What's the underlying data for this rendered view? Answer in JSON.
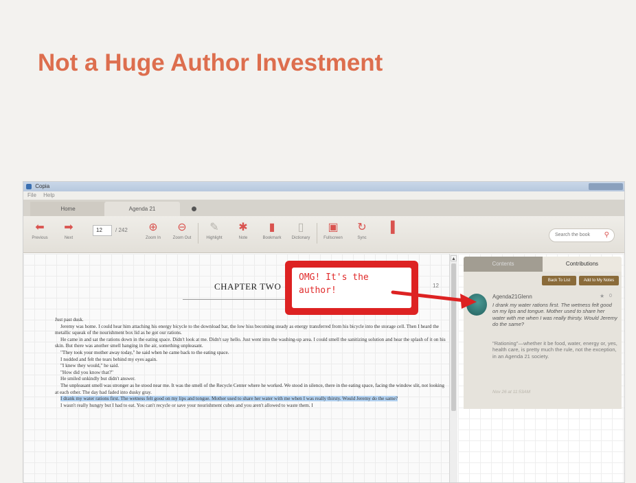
{
  "slide": {
    "title": "Not a Huge Author Investment"
  },
  "window": {
    "title": "Copia"
  },
  "menu": [
    "File",
    "Help"
  ],
  "tabs": [
    {
      "label": "Home"
    },
    {
      "label": "Agenda 21"
    }
  ],
  "toolbar": {
    "previous": "Previous",
    "next": "Next",
    "page_value": "12",
    "page_total": "/ 242",
    "zoom_in": "Zoom In",
    "zoom_out": "Zoom Out",
    "highlight": "Highlight",
    "note": "Note",
    "bookmark": "Bookmark",
    "dictionary": "Dictionary",
    "fullscreen": "Fullscreen",
    "sync": "Sync",
    "search_placeholder": "Search the book"
  },
  "reader": {
    "chapter_title": "CHAPTER TWO",
    "page_number": "12",
    "paragraphs": [
      "Jeremy was home. I could hear him attaching his energy bicycle to the download bar, the low hiss becoming steady as energy transferred from his bicycle into the storage cell. Then I heard the metallic squeak of the nourishment box lid as he got our rations.",
      "He came in and sat the rations down in the eating space. Didn't look at me. Didn't say hello. Just went into the washing-up area. I could smell the sanitizing solution and hear the splash of it on his skin. But there was another smell hanging in the air, something unpleasant.",
      "\"They took your mother away today,\" he said when he came back to the eating space.",
      "I nodded and felt the tears behind my eyes again.",
      "\"I knew they would,\" he said.",
      "\"How did you know that?\"",
      "He smiled unkindly but didn't answer.",
      "The unpleasant smell was stronger as he stood near me. It was the smell of the Recycle Center where he worked. We stood in silence, there in the eating space, facing the window slit, not looking at each other. The day had faded into dusky gray."
    ],
    "opening_line": "Just past dusk.",
    "highlighted": "I drank my water rations first. The wetness felt good on my lips and tongue. Mother used to share her water with me when I was really thirsty. Would Jeremy do the same?",
    "last_paragraph": "I wasn't really hungry but I had to eat. You can't recycle or save your nourishment cubes and you aren't allowed to waste them. I"
  },
  "sidebar": {
    "tab_contents": "Contents",
    "tab_contributions": "Contributions",
    "back_button": "Back To List",
    "add_button": "Add to My Notes",
    "username": "Agenda21Glenn",
    "star_count": "0",
    "quote": "I drank my water rations first. The wetness felt good on my lips and tongue. Mother used to share her water with me when I was really thirsty. Would Jeremy do the same?",
    "note": "\"Rationing\"—whether it be food, water, energy or, yes, health care, is pretty much the rule, not the exception, in an Agenda 21 society.",
    "date": "Nov 26 at 11:53AM"
  },
  "callout": {
    "line1": "OMG! It's the",
    "line2": "author!",
    "color": "#dd2222"
  },
  "colors": {
    "title": "#dd6e4e",
    "accent": "#d9534f",
    "highlight": "#b4d3f2"
  }
}
